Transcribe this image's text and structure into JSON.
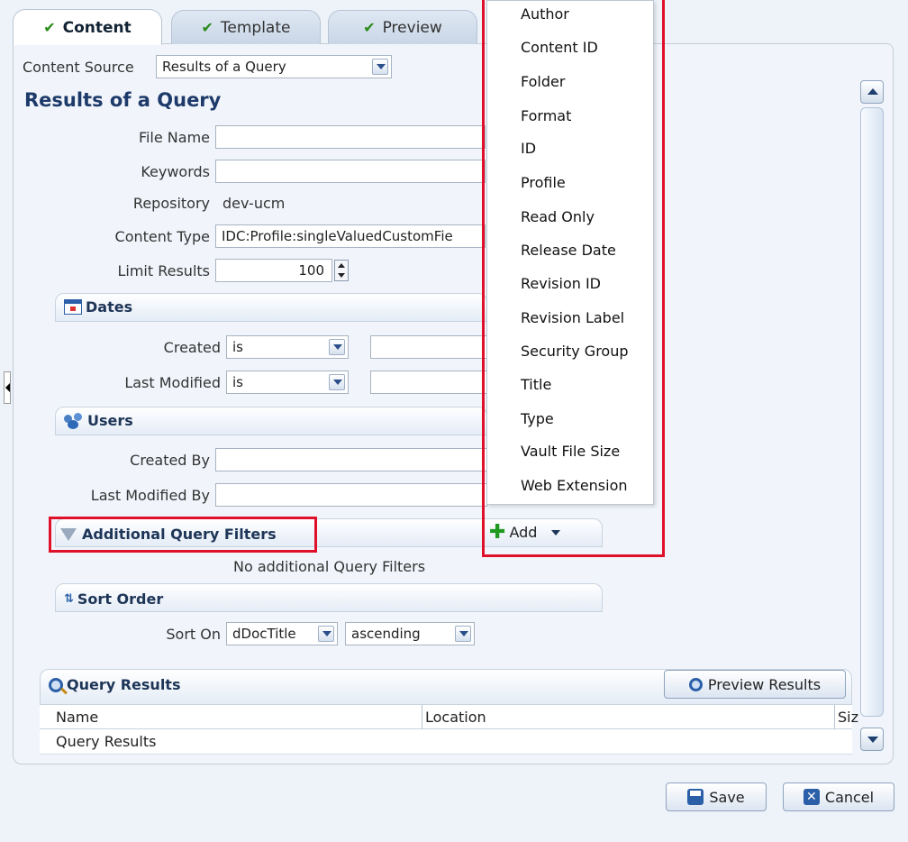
{
  "tabs": [
    {
      "label": "Content",
      "icon": "check-icon"
    },
    {
      "label": "Template",
      "icon": "check-icon"
    },
    {
      "label": "Preview",
      "icon": "check-icon"
    }
  ],
  "content_source": {
    "label": "Content Source",
    "value": "Results of a Query"
  },
  "page_title": "Results of a Query",
  "fields": {
    "file_name": {
      "label": "File Name",
      "value": ""
    },
    "keywords": {
      "label": "Keywords",
      "value": ""
    },
    "repository": {
      "label": "Repository",
      "value": "dev-ucm"
    },
    "content_type": {
      "label": "Content Type",
      "value": "IDC:Profile:singleValuedCustomFie"
    },
    "limit_results": {
      "label": "Limit Results",
      "value": "100"
    }
  },
  "dates": {
    "title": "Dates",
    "created": {
      "label": "Created",
      "operator": "is",
      "value": ""
    },
    "last_modified": {
      "label": "Last Modified",
      "operator": "is",
      "value": ""
    }
  },
  "users": {
    "title": "Users",
    "created_by": {
      "label": "Created By",
      "value": ""
    },
    "last_modified_by": {
      "label": "Last Modified By",
      "value": ""
    }
  },
  "filters": {
    "title": "Additional Query Filters",
    "add_label": "Add",
    "empty_text": "No additional Query Filters"
  },
  "sort": {
    "title": "Sort Order",
    "label": "Sort On",
    "field": "dDocTitle",
    "direction": "ascending"
  },
  "results": {
    "title": "Query Results",
    "preview_button": "Preview Results",
    "columns": [
      "Name",
      "Location",
      "Siz"
    ],
    "rows": [
      "Query Results"
    ]
  },
  "menu": {
    "items": [
      "Author",
      "Content ID",
      "Folder",
      "Format",
      "ID",
      "Profile",
      "Read Only",
      "Release Date",
      "Revision ID",
      "Revision Label",
      "Security Group",
      "Title",
      "Type",
      "Vault File Size",
      "Web Extension"
    ]
  },
  "footer": {
    "save": "Save",
    "cancel": "Cancel"
  },
  "colors": {
    "highlight": "#e0102a",
    "title": "#1d3a6a"
  }
}
